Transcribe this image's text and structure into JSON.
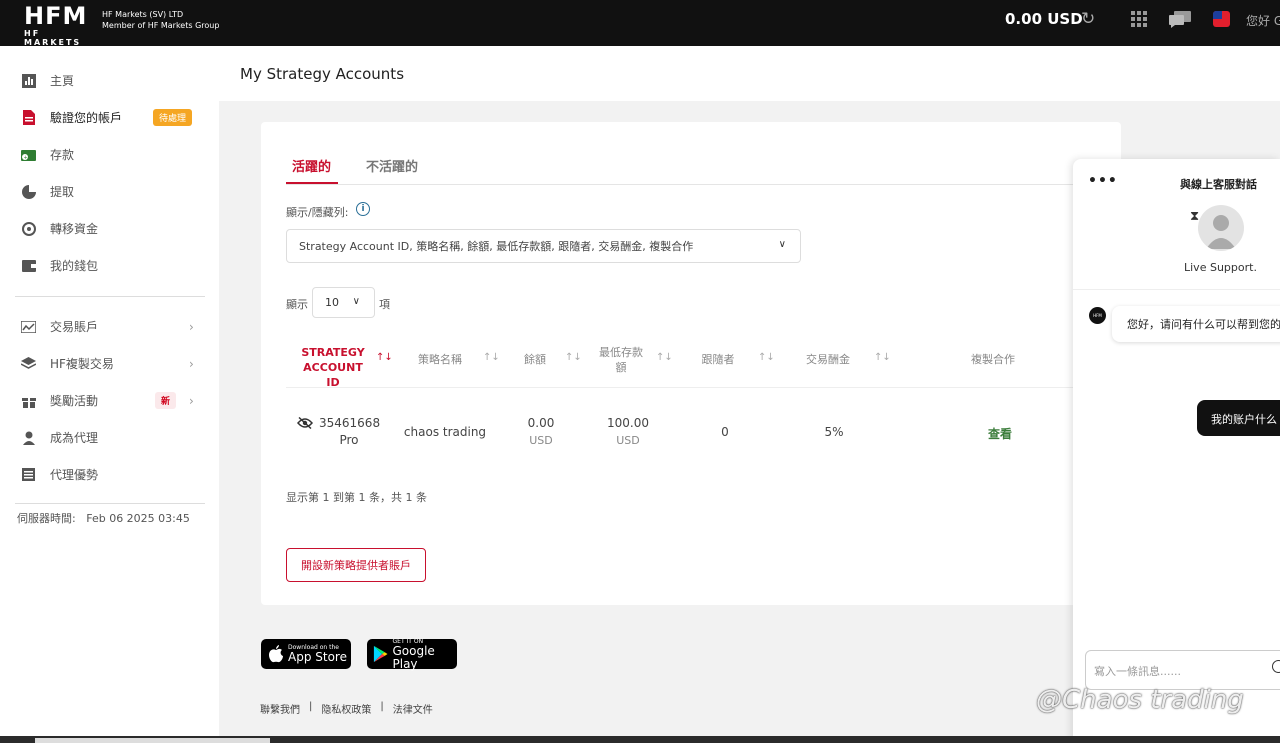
{
  "header": {
    "logo_text": "HFM",
    "logo_sub": "HF MARKETS",
    "company_line1": "HF Markets (SV) LTD",
    "company_line2": "Member of HF Markets Group",
    "balance": "0.00 USD",
    "greeting": "您好 G"
  },
  "sidebar": {
    "items": [
      {
        "label": "主頁",
        "icon": "bar-chart-icon"
      },
      {
        "label": "驗證您的帳戶",
        "icon": "document-icon",
        "badge": "待處理"
      },
      {
        "label": "存款",
        "icon": "wallet-in-icon"
      },
      {
        "label": "提取",
        "icon": "pie-icon"
      },
      {
        "label": "轉移資金",
        "icon": "transfer-icon"
      },
      {
        "label": "我的錢包",
        "icon": "wallet-icon"
      },
      {
        "label": "交易賬戶",
        "icon": "chart-line-icon"
      },
      {
        "label": "HF複製交易",
        "icon": "layers-icon"
      },
      {
        "label": "獎勵活動",
        "icon": "gift-icon",
        "badge": "新"
      },
      {
        "label": "成為代理",
        "icon": "user-icon"
      },
      {
        "label": "代理優勢",
        "icon": "list-icon"
      }
    ],
    "server_time_label": "伺服器時間:",
    "server_time": "Feb 06 2025 03:45"
  },
  "page": {
    "title": "My Strategy Accounts"
  },
  "tabs": {
    "active": "活躍的",
    "inactive": "不活躍的"
  },
  "columns_filter": {
    "label": "顯示/隱藏列:",
    "value": "Strategy Account ID, 策略名稱, 餘額, 最低存款額, 跟隨者, 交易酬金, 複製合作"
  },
  "entries": {
    "prefix": "顯示",
    "value": "10",
    "suffix": "項"
  },
  "table": {
    "headers": {
      "id_line1": "STRATEGY",
      "id_line2": "ACCOUNT ID",
      "name": "策略名稱",
      "balance": "餘額",
      "min_line1": "最低存款",
      "min_line2": "額",
      "followers": "跟隨者",
      "fee": "交易酬金",
      "copy": "複製合作"
    },
    "rows": [
      {
        "id": "35461668",
        "type": "Pro",
        "name": "chaos trading",
        "balance": "0.00",
        "balance_ccy": "USD",
        "min_deposit": "100.00",
        "min_ccy": "USD",
        "followers": "0",
        "fee": "5%",
        "action": "查看"
      }
    ],
    "info": "显示第 1 到第 1 条，共 1 条"
  },
  "new_button": "開設新策略提供者賬戶",
  "stores": {
    "apple_small": "Download on the",
    "apple_big": "App Store",
    "google_small": "GET IT ON",
    "google_big": "Google Play"
  },
  "footer": {
    "contact": "聯繫我們",
    "sep": "|",
    "privacy": "隐私权政策",
    "legal": "法律文件"
  },
  "chat": {
    "title": "與線上客服對話",
    "agent": "Live Support.",
    "agent_logo": "HFM",
    "msg_in": "您好，请问有什么可以帮到您的",
    "msg_out": "我的账户什么",
    "input_placeholder": "寫入一條訊息......"
  },
  "watermark": "@Chaos trading"
}
